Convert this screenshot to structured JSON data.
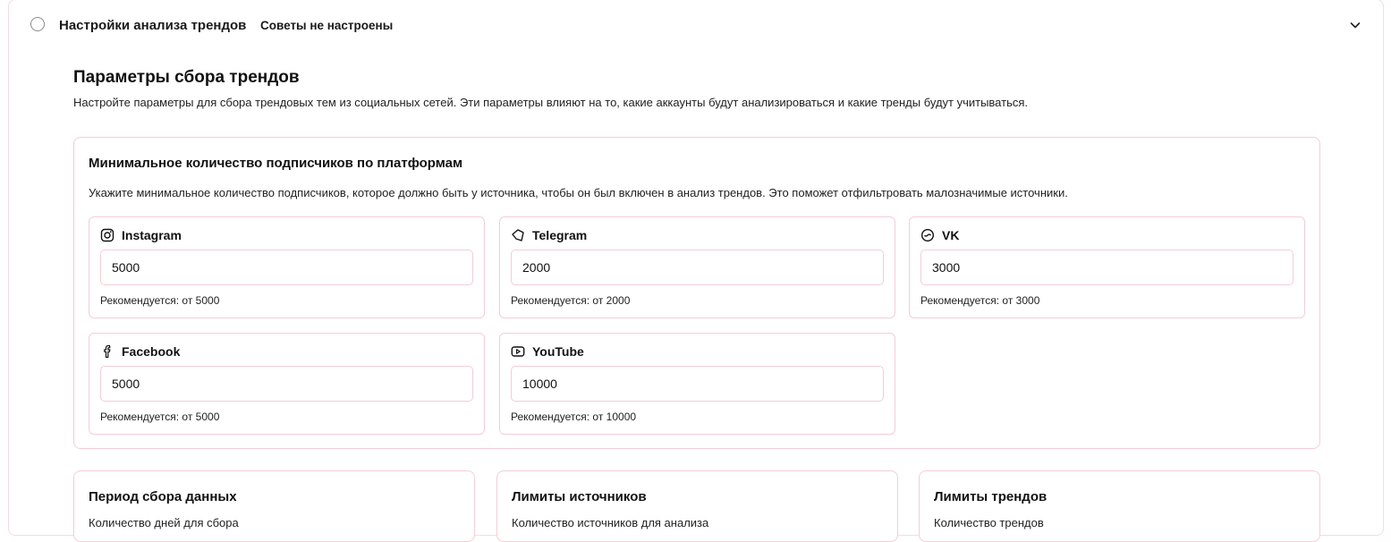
{
  "accordion": {
    "title": "Настройки анализа трендов",
    "status": "Советы не настроены"
  },
  "section": {
    "title": "Параметры сбора трендов",
    "description": "Настройте параметры для сбора трендовых тем из социальных сетей. Эти параметры влияют на то, какие аккаунты будут анализироваться и какие тренды будут учитываться."
  },
  "subscribers_card": {
    "title": "Минимальное количество подписчиков по платформам",
    "description": "Укажите минимальное количество подписчиков, которое должно быть у источника, чтобы он был включен в анализ трендов. Это поможет отфильтровать малозначимые источники.",
    "platforms": [
      {
        "name": "Instagram",
        "icon": "instagram-icon",
        "value": "5000",
        "hint": "Рекомендуется: от 5000"
      },
      {
        "name": "Telegram",
        "icon": "telegram-icon",
        "value": "2000",
        "hint": "Рекомендуется: от 2000"
      },
      {
        "name": "VK",
        "icon": "vk-icon",
        "value": "3000",
        "hint": "Рекомендуется: от 3000"
      },
      {
        "name": "Facebook",
        "icon": "facebook-icon",
        "value": "5000",
        "hint": "Рекомендуется: от 5000"
      },
      {
        "name": "YouTube",
        "icon": "youtube-icon",
        "value": "10000",
        "hint": "Рекомендуется: от 10000"
      }
    ]
  },
  "bottom_cards": [
    {
      "title": "Период сбора данных",
      "description": "Количество дней для сбора"
    },
    {
      "title": "Лимиты источников",
      "description": "Количество источников для анализа"
    },
    {
      "title": "Лимиты трендов",
      "description": "Количество трендов"
    }
  ],
  "colors": {
    "border_pink": "#f5cdd6",
    "text_primary": "#111111",
    "icon_gray": "#8a8a8a"
  }
}
